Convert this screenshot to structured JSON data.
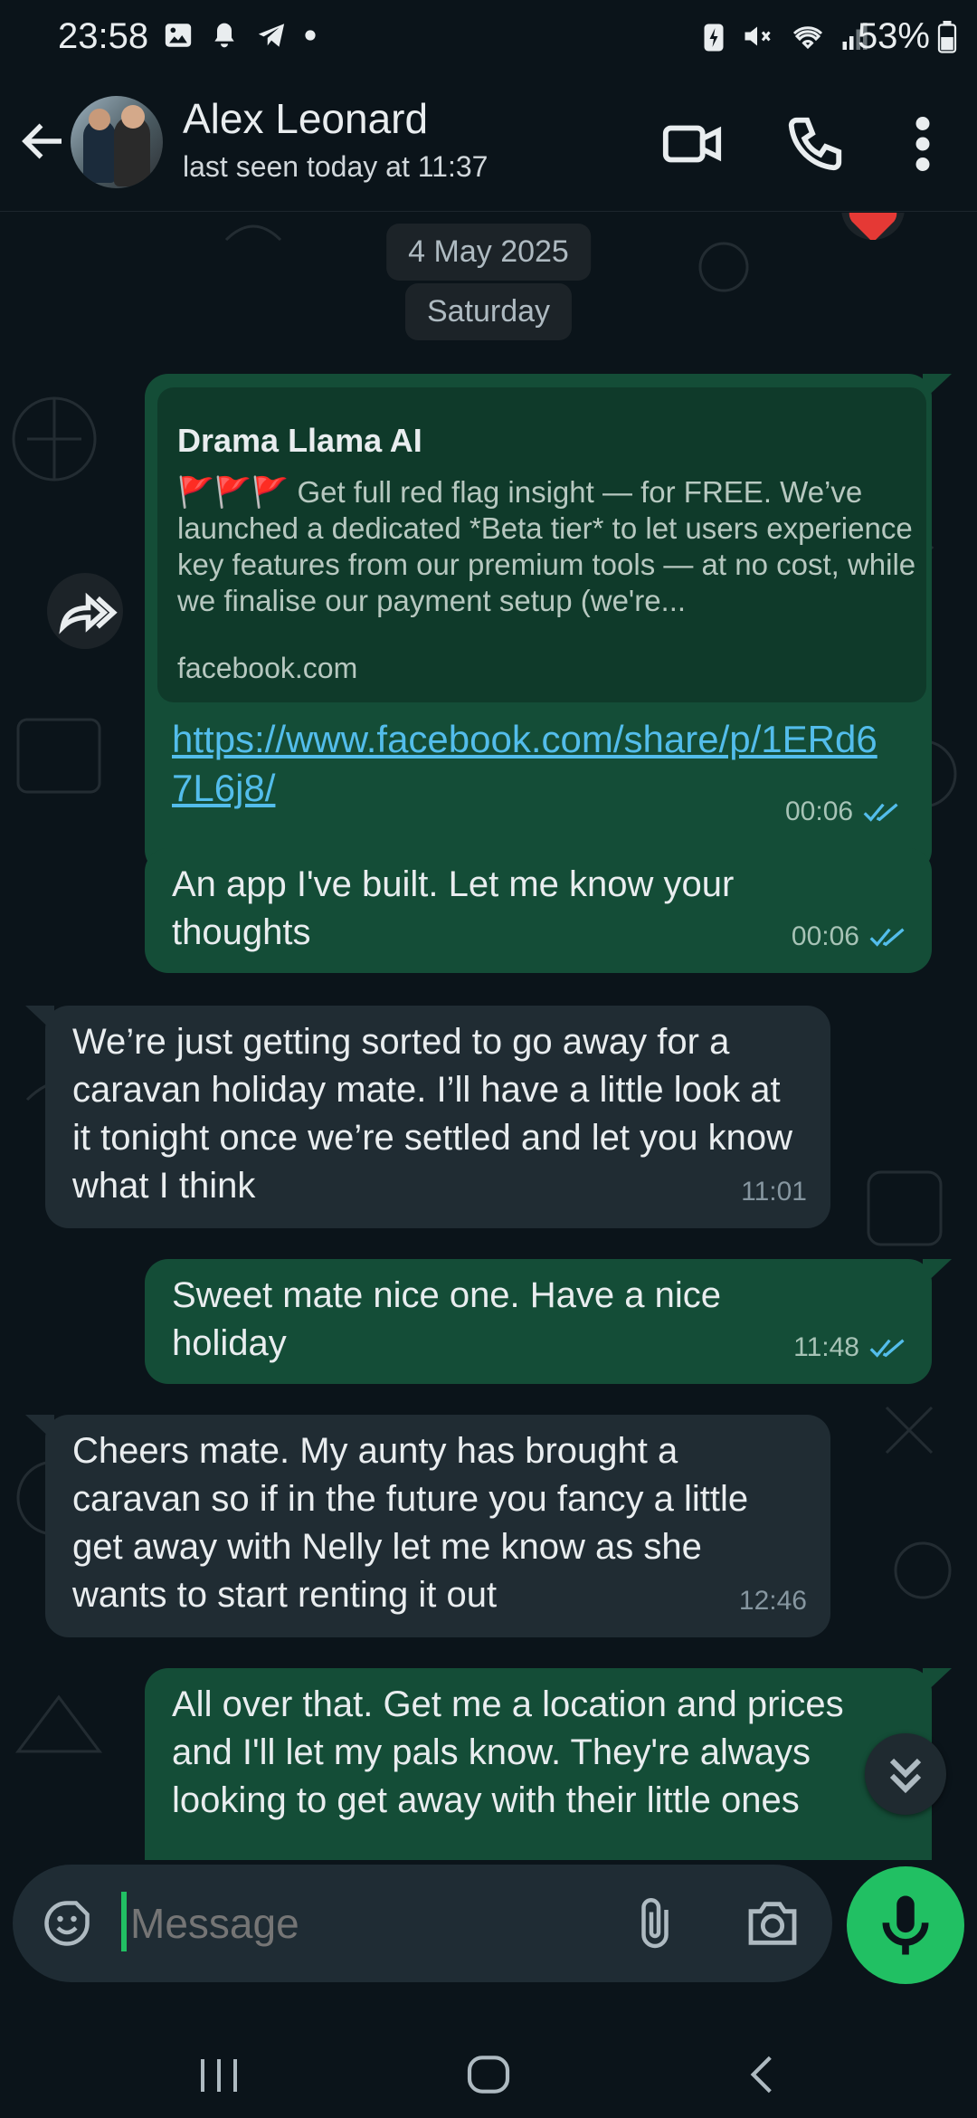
{
  "status_bar": {
    "time": "23:58",
    "battery": "53%"
  },
  "header": {
    "name": "Alex Leonard",
    "last_seen": "last seen today at 11:37"
  },
  "chat": {
    "date": "4 May 2025",
    "day": "Saturday",
    "messages": [
      {
        "preview_title": "Drama Llama AI",
        "preview_flags": "🚩🚩🚩",
        "preview_desc": "Get full red flag insight — for FREE. We’ve launched a dedicated *Beta tier* to let users experience key features from our premium tools — at no cost, while we finalise our payment setup (we're...",
        "preview_domain": "facebook.com",
        "link": "https://www.facebook.com/share/p/1ERd67L6j8/",
        "time": "00:06"
      },
      {
        "text": "An app I've built. Let me know your thoughts",
        "time": "00:06"
      },
      {
        "text": "We’re just getting sorted to go away for a caravan holiday mate. I’ll have a little look at it tonight once we’re settled and let you know what I think",
        "time": "11:01"
      },
      {
        "text": "Sweet mate nice one. Have a nice holiday",
        "time": "11:48"
      },
      {
        "text": "Cheers mate. My aunty has brought a caravan so if in the future you fancy a little get away with Nelly let me know as she wants to start renting it out",
        "time": "12:46"
      },
      {
        "text": "All over that. Get me a location and prices and I'll let my pals know. They're always looking to get away with their little ones"
      }
    ]
  },
  "input": {
    "placeholder": "Message"
  },
  "colors": {
    "background": "#0b141a",
    "outgoing_bubble": "#144d37",
    "incoming_bubble": "#202c33",
    "accent": "#21c063",
    "link": "#53bdeb",
    "read_tick": "#53bdeb"
  }
}
